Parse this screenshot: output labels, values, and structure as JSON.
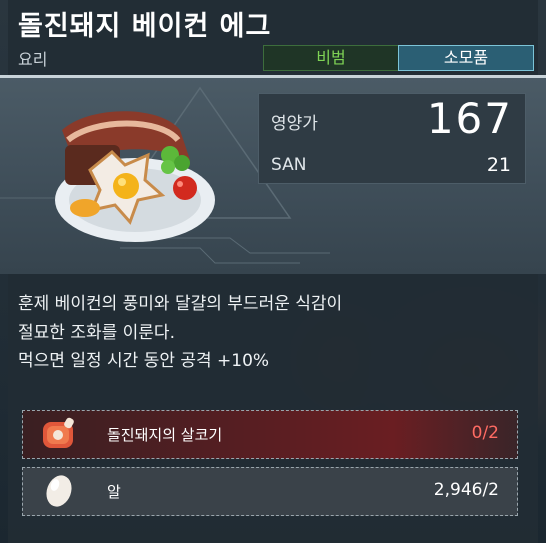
{
  "item": {
    "title": "돌진돼지 베이컨 에그",
    "category": "요리",
    "tags": [
      "비범",
      "소모품"
    ]
  },
  "stats": {
    "nutrition_label": "영양가",
    "nutrition_value": "167",
    "san_label": "SAN",
    "san_value": "21"
  },
  "description": {
    "line1": "훈제 베이컨의 풍미와 달걀의 부드러운 식감이",
    "line2": "절묘한 조화를 이룬다.",
    "line3": "먹으면 일정 시간 동안 공격 +10%"
  },
  "ingredients": [
    {
      "name": "돌진돼지의 살코기",
      "count": "0/2",
      "icon": "meat-drumstick-icon"
    },
    {
      "name": "알",
      "count": "2,946/2",
      "icon": "egg-icon"
    }
  ],
  "colors": {
    "tag_rare": "#7fd455",
    "tag_consumable_bg": "#2b5f74",
    "missing_count": "#ff6b63"
  }
}
